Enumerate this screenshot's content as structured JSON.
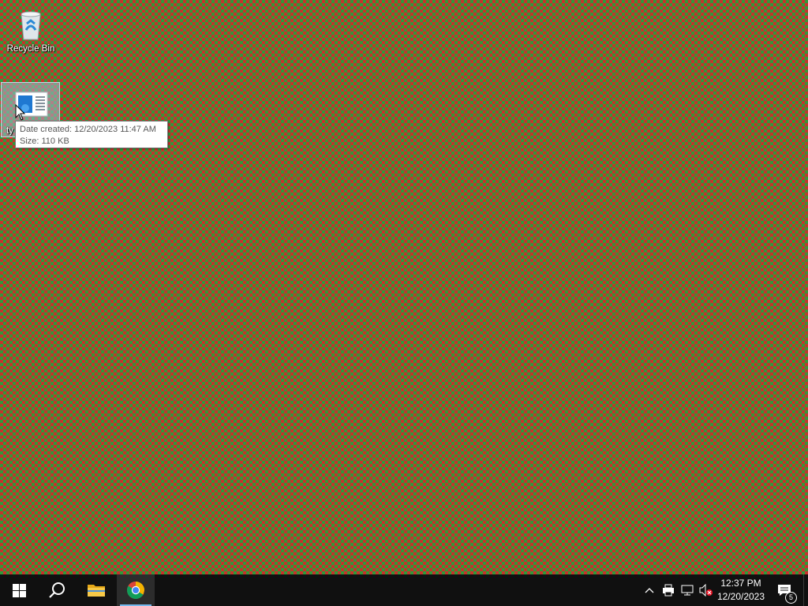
{
  "desktop": {
    "icons": [
      {
        "label": "Recycle Bin",
        "icon": "recycle-bin-icon"
      },
      {
        "label": "ty",
        "icon": "document-file-icon",
        "selected": true
      }
    ],
    "tooltip": {
      "date_created": "Date created: 12/20/2023 11:47 AM",
      "size": "Size: 110 KB"
    },
    "colors": {
      "checker_red": "#c8312b",
      "checker_green": "#2f9a3a"
    }
  },
  "taskbar": {
    "start_icon": "windows-logo-icon",
    "search_icon": "search-icon",
    "pinned": [
      {
        "name": "File Explorer",
        "icon": "folder-icon"
      },
      {
        "name": "Google Chrome",
        "icon": "chrome-icon",
        "active": true
      }
    ],
    "tray": {
      "icons": [
        "chevron-up-icon",
        "printer-icon",
        "network-icon",
        "volume-muted-icon"
      ],
      "time": "12:37 PM",
      "date": "12/20/2023",
      "notification_count": "5"
    }
  }
}
